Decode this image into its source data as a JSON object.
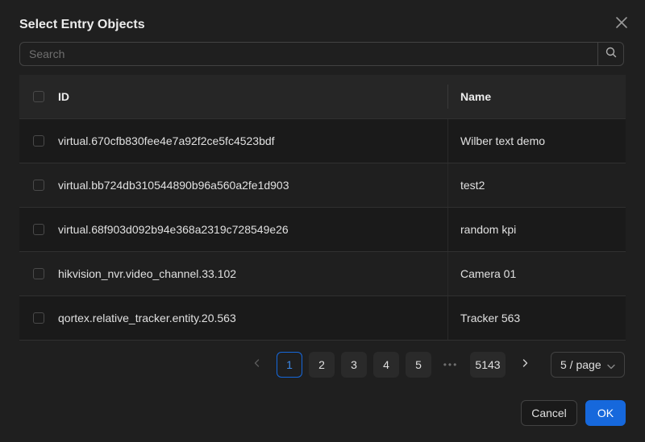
{
  "dialog": {
    "title": "Select Entry Objects",
    "close_icon": "close-icon"
  },
  "search": {
    "placeholder": "Search",
    "value": "",
    "icon": "search-icon"
  },
  "table": {
    "columns": [
      "ID",
      "Name"
    ],
    "rows": [
      {
        "id": "virtual.670cfb830fee4e7a92f2ce5fc4523bdf",
        "name": "Wilber text demo"
      },
      {
        "id": "virtual.bb724db310544890b96a560a2fe1d903",
        "name": "test2"
      },
      {
        "id": "virtual.68f903d092b94e368a2319c728549e26",
        "name": "random kpi"
      },
      {
        "id": "hikvision_nvr.video_channel.33.102",
        "name": "Camera 01"
      },
      {
        "id": "qortex.relative_tracker.entity.20.563",
        "name": "Tracker 563"
      }
    ]
  },
  "pagination": {
    "pages": [
      "1",
      "2",
      "3",
      "4",
      "5"
    ],
    "current": "1",
    "ellipsis": "•••",
    "last": "5143",
    "page_size": "5 / page"
  },
  "footer": {
    "cancel_label": "Cancel",
    "ok_label": "OK"
  },
  "colors": {
    "accent": "#1668dc",
    "background": "#1f1f1f"
  }
}
